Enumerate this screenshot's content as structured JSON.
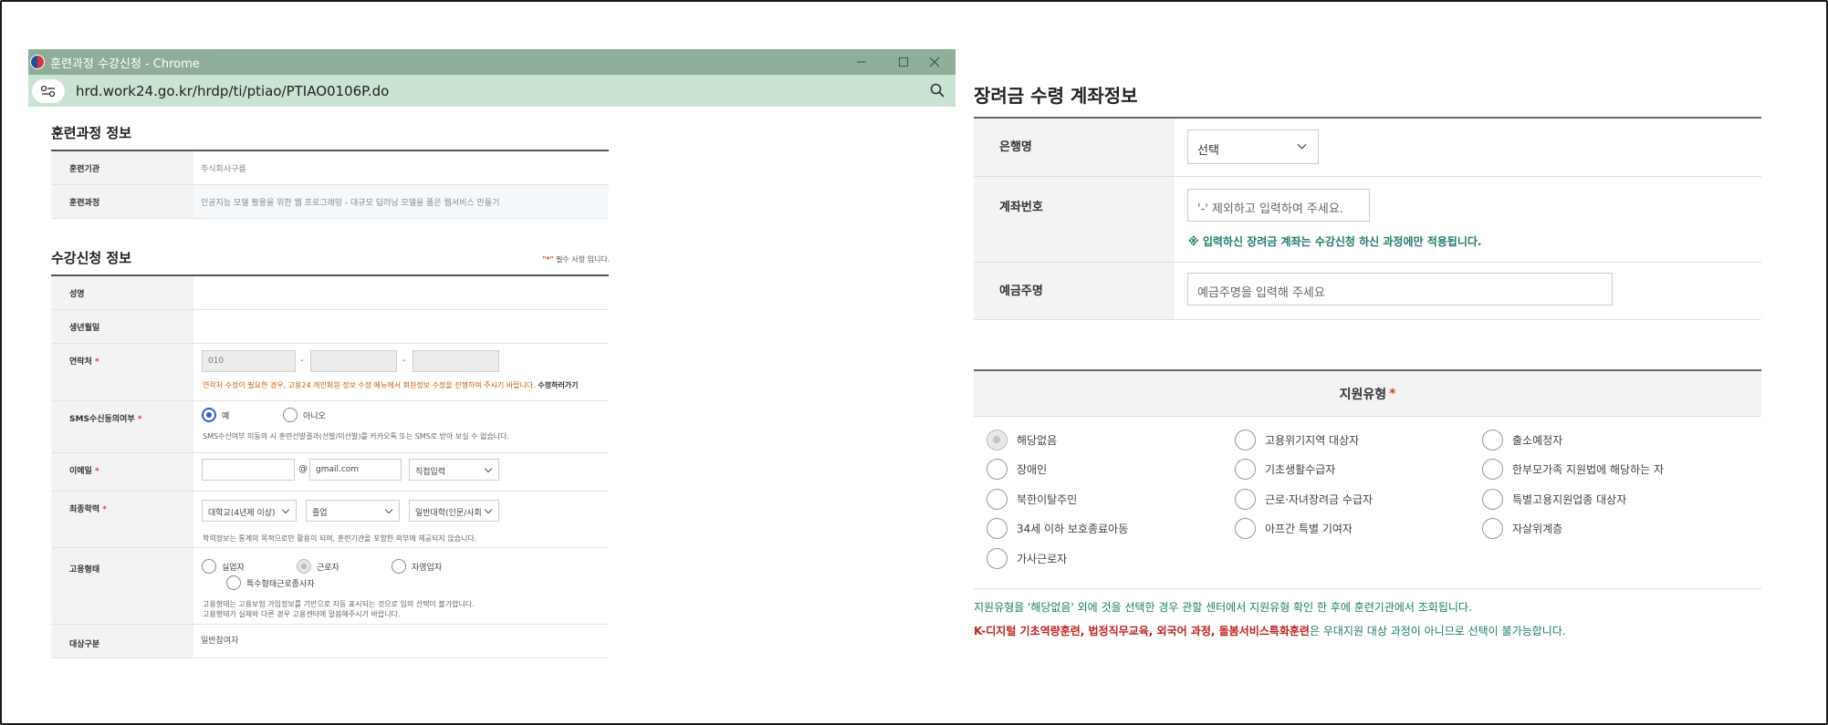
{
  "browser": {
    "title": "훈련과정 수강신청 - Chrome",
    "url": "hrd.work24.go.kr/hrdp/ti/ptiao/PTIAO0106P.do"
  },
  "course_info": {
    "title": "훈련과정 정보",
    "rows": [
      {
        "label": "훈련기관",
        "value": "주식회사구름"
      },
      {
        "label": "훈련과정",
        "value": "인공지능 모델 활용을 위한 웹 프로그래밍 - 대규모 딥러닝 모델을 품은 웹서비스 만들기"
      }
    ]
  },
  "apply_info": {
    "title": "수강신청 정보",
    "required_note_star": "\"*\"",
    "required_note": " 필수 사항 입니다.",
    "star": "*",
    "labels": {
      "name": "성명",
      "birth": "생년월일",
      "contact": "연락처",
      "sms": "SMS수신동의여부",
      "email": "이메일",
      "education": "최종학력",
      "employment": "고용형태",
      "target": "대상구분"
    },
    "contact": {
      "phone1": "010",
      "separator": "-",
      "note": "연락처 수정이 필요한 경우, 고용24 개인회원 정보 수정 메뉴에서 회원정보 수정을 진행하여 주시기 바랍니다.",
      "link": "수정하러가기"
    },
    "sms": {
      "yes": "예",
      "no": "아니오",
      "note": "SMS수신여부 미동의 시 훈련선발결과(선발/미선발)를 카카오톡 또는 SMS로 받아 보실 수 없습니다."
    },
    "email": {
      "at": "@",
      "domain": "gmail.com",
      "select": "직접입력"
    },
    "education": {
      "level": "대학교(4년제 이상)",
      "status": "졸업",
      "school": "일반대학(인문/사회",
      "note": "학력정보는 통계의 목적으로만 활용이 되며, 훈련기관을 포함한 외부에 제공되지 않습니다."
    },
    "employment": {
      "options": [
        "실업자",
        "근로자",
        "자영업자",
        "특수형태근로종사자"
      ],
      "note1": "고용형태는 고용보험 가입정보를 기반으로 자동 표시되는 것으로 임의 선택이 불가합니다.",
      "note2": "고용형태가 실제와 다른 경우 고용센터에 말씀해주시기 바랍니다."
    },
    "target_value": "일반참여자"
  },
  "account": {
    "title": "장려금 수령 계좌정보",
    "bank_label": "은행명",
    "bank_select": "선택",
    "account_label": "계좌번호",
    "account_placeholder": "'-' 제외하고 입력하여 주세요.",
    "account_note": "※ 입력하신 장려금 계좌는 수강신청 하신 과정에만 적용됩니다.",
    "holder_label": "예금주명",
    "holder_placeholder": "예금주명을 입력해 주세요"
  },
  "support": {
    "title": "지원유형",
    "star": "*",
    "options": [
      "해당없음",
      "고용위기지역 대상자",
      "출소예정자",
      "장애인",
      "기초생활수급자",
      "한부모가족 지원법에 해당하는 자",
      "북한이탈주민",
      "근로·자녀장려금 수급자",
      "특별고용지원업종 대상자",
      "34세 이하 보호종료아동",
      "아프간 특별 기여자",
      "자살위계층",
      "가사근로자"
    ],
    "note1": "지원유형을 '해당없음' 외에 것을 선택한 경우 관할 센터에서 지원유형 확인 한 후에 훈련기관에서 조회됩니다.",
    "note2_red": "K-디지털 기초역량훈련, 법정직무교육, 외국어 과정, 돌봄서비스특화훈련",
    "note2_rest": "은 우대지원 대상 과정이 아니므로 선택이 불가능합니다."
  }
}
